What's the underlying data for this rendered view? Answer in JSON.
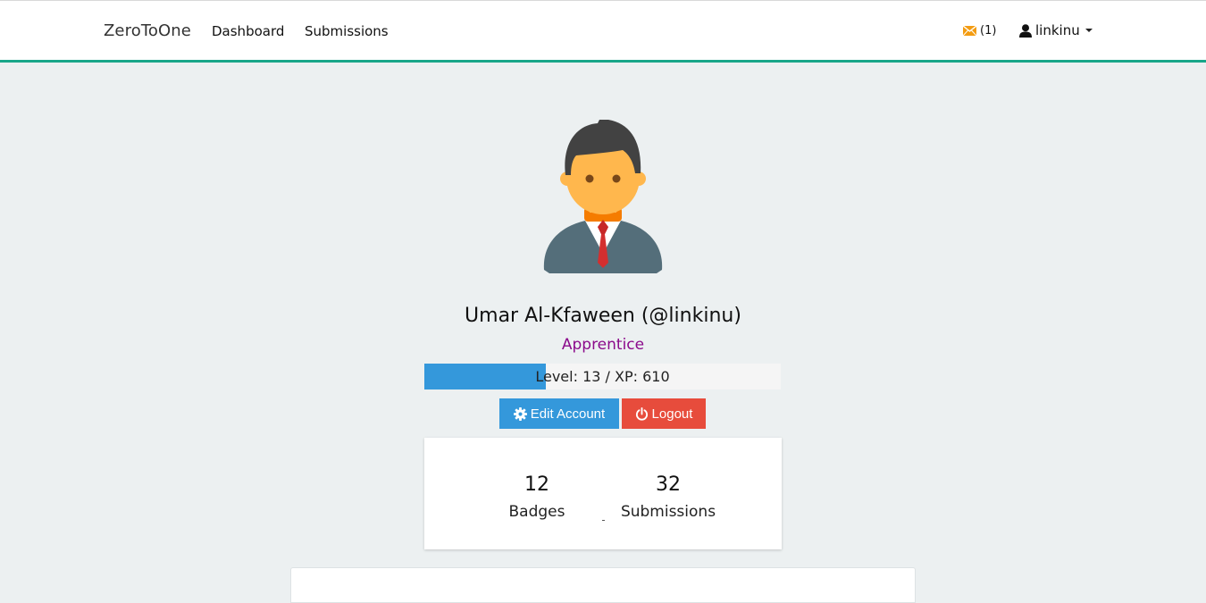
{
  "navbar": {
    "brand": "ZeroToOne",
    "links": [
      {
        "label": "Dashboard"
      },
      {
        "label": "Submissions"
      }
    ],
    "messages": {
      "icon": "envelope-icon",
      "count_text": "(1)"
    },
    "user": {
      "icon": "user-icon",
      "username": "linkinu"
    }
  },
  "profile": {
    "avatar": "businessman-avatar",
    "display_name": "Umar Al-Kfaween (@linkinu)",
    "rank": "Apprentice",
    "xp_text": "Level: 13 / XP: 610",
    "xp_progress_percent": 34,
    "edit_button": "Edit Account",
    "logout_button": "Logout"
  },
  "stats": {
    "badges_value": "12",
    "badges_label": "Badges",
    "submissions_value": "32",
    "submissions_label": "Submissions"
  },
  "colors": {
    "accent": "#18a689",
    "primary": "#3498db",
    "danger": "#e74c3c",
    "rank": "#8b0a8b",
    "background": "#ecf0f1"
  }
}
